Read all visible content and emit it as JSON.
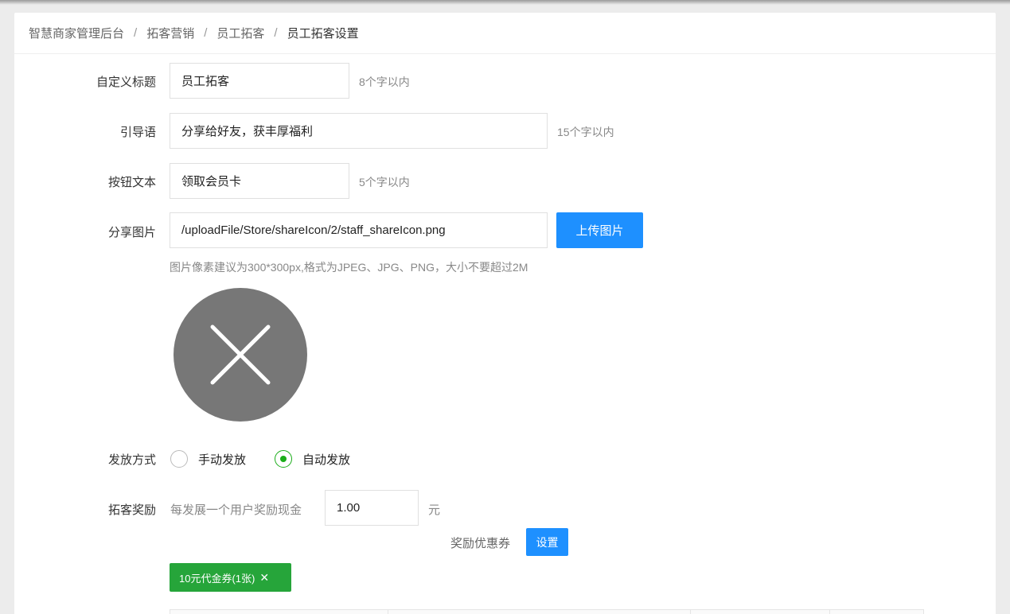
{
  "breadcrumb": {
    "items": [
      "智慧商家管理后台",
      "拓客营销",
      "员工拓客",
      "员工拓客设置"
    ],
    "separator": "/"
  },
  "form": {
    "title": {
      "label": "自定义标题",
      "value": "员工拓客",
      "hint": "8个字以内"
    },
    "guide": {
      "label": "引导语",
      "value": "分享给好友，获丰厚福利",
      "hint": "15个字以内"
    },
    "button_text": {
      "label": "按钮文本",
      "value": "领取会员卡",
      "hint": "5个字以内"
    },
    "share_image": {
      "label": "分享图片",
      "value": "/uploadFile/Store/shareIcon/2/staff_shareIcon.png",
      "upload_label": "上传图片",
      "hint": "图片像素建议为300*300px,格式为JPEG、JPG、PNG，大小不要超过2M",
      "preview_icon": "close-x-icon"
    },
    "issue_method": {
      "label": "发放方式",
      "options": [
        "手动发放",
        "自动发放"
      ],
      "selected": "自动发放"
    },
    "reward": {
      "label": "拓客奖励",
      "prefix": "每发展一个用户奖励现金",
      "value": "1.00",
      "unit": "元",
      "coupon_label": "奖励优惠券",
      "coupon_button": "设置",
      "coupon_tag": "10元代金券(1张)"
    }
  },
  "colors": {
    "primary": "#1e90ff",
    "success": "#1aad19",
    "tag": "#26a53a"
  }
}
